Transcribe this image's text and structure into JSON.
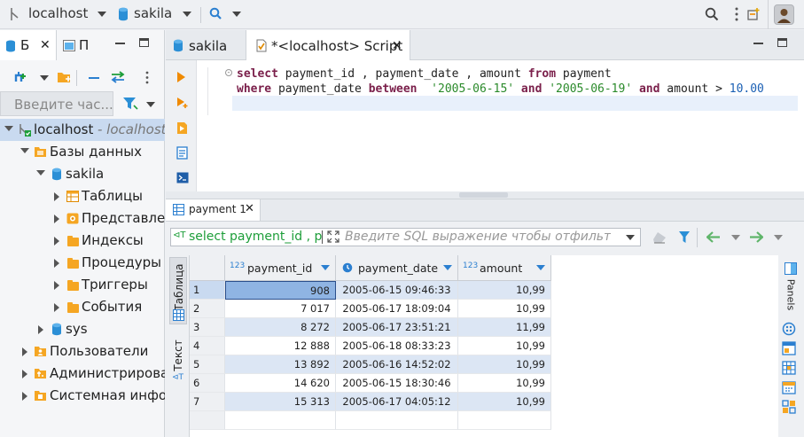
{
  "toolbar": {
    "connection": "localhost",
    "database": "sakila"
  },
  "left_panel": {
    "tab1": "Б",
    "tab2": "П",
    "filter_placeholder": "Введите час...",
    "tree": [
      {
        "label": "localhost",
        "suffix": " - localhost",
        "level": 0,
        "expanded": true
      },
      {
        "label": "Базы данных",
        "level": 1,
        "expanded": true
      },
      {
        "label": "sakila",
        "level": 2,
        "expanded": true
      },
      {
        "label": "Таблицы",
        "level": 3,
        "expanded": false
      },
      {
        "label": "Представления",
        "level": 3,
        "expanded": false
      },
      {
        "label": "Индексы",
        "level": 3,
        "expanded": false
      },
      {
        "label": "Процедуры",
        "level": 3,
        "expanded": false
      },
      {
        "label": "Триггеры",
        "level": 3,
        "expanded": false
      },
      {
        "label": "События",
        "level": 3,
        "expanded": false
      },
      {
        "label": "sys",
        "level": 2,
        "expanded": false
      },
      {
        "label": "Пользователи",
        "level": 1,
        "expanded": false
      },
      {
        "label": "Администрирование",
        "level": 1,
        "expanded": false
      },
      {
        "label": "Системная информация",
        "level": 1,
        "expanded": false
      }
    ]
  },
  "editor_tabs": [
    {
      "label": "sakila",
      "active": false
    },
    {
      "label": "*<localhost> Script",
      "active": true
    }
  ],
  "sql": {
    "line1": {
      "kw1": "select",
      "t1": " payment_id , payment_date , amount ",
      "kw2": "from",
      "t2": " payment"
    },
    "line2": {
      "kw1": "where",
      "t1": " payment_date ",
      "kw2": "between",
      "t2": "  ",
      "s1": "'2005-06-15'",
      "t3": " ",
      "kw3": "and",
      "t4": " ",
      "s2": "'2005-06-19'",
      "t5": " ",
      "kw4": "and",
      "t6": " amount > ",
      "n1": "10.00"
    }
  },
  "results": {
    "tab_label": "payment 1",
    "filter_query": "select payment_id , p",
    "filter_placeholder": "Введите SQL выражение чтобы отфильтровать результаты",
    "side_tab_table": "Таблица",
    "side_tab_text": "Текст",
    "right_panel_label": "Panels",
    "columns": [
      {
        "type": "123",
        "name": "payment_id"
      },
      {
        "type": "clock",
        "name": "payment_date"
      },
      {
        "type": "123",
        "name": "amount"
      }
    ],
    "rows": [
      {
        "n": "1",
        "payment_id": "908",
        "payment_date": "2005-06-15 09:46:33",
        "amount": "10,99"
      },
      {
        "n": "2",
        "payment_id": "7 017",
        "payment_date": "2005-06-17 18:09:04",
        "amount": "10,99"
      },
      {
        "n": "3",
        "payment_id": "8 272",
        "payment_date": "2005-06-17 23:51:21",
        "amount": "11,99"
      },
      {
        "n": "4",
        "payment_id": "12 888",
        "payment_date": "2005-06-18 08:33:23",
        "amount": "10,99"
      },
      {
        "n": "5",
        "payment_id": "13 892",
        "payment_date": "2005-06-16 14:52:02",
        "amount": "10,99"
      },
      {
        "n": "6",
        "payment_id": "14 620",
        "payment_date": "2005-06-15 18:30:46",
        "amount": "10,99"
      },
      {
        "n": "7",
        "payment_id": "15 313",
        "payment_date": "2005-06-17 04:05:12",
        "amount": "10,99"
      }
    ]
  },
  "colors": {
    "keyword": "#7a1f4a",
    "string": "#2a8a2a",
    "number": "#1a5fb4",
    "row_highlight": "#dce6f4",
    "selected_cell": "#8fb4e3"
  }
}
